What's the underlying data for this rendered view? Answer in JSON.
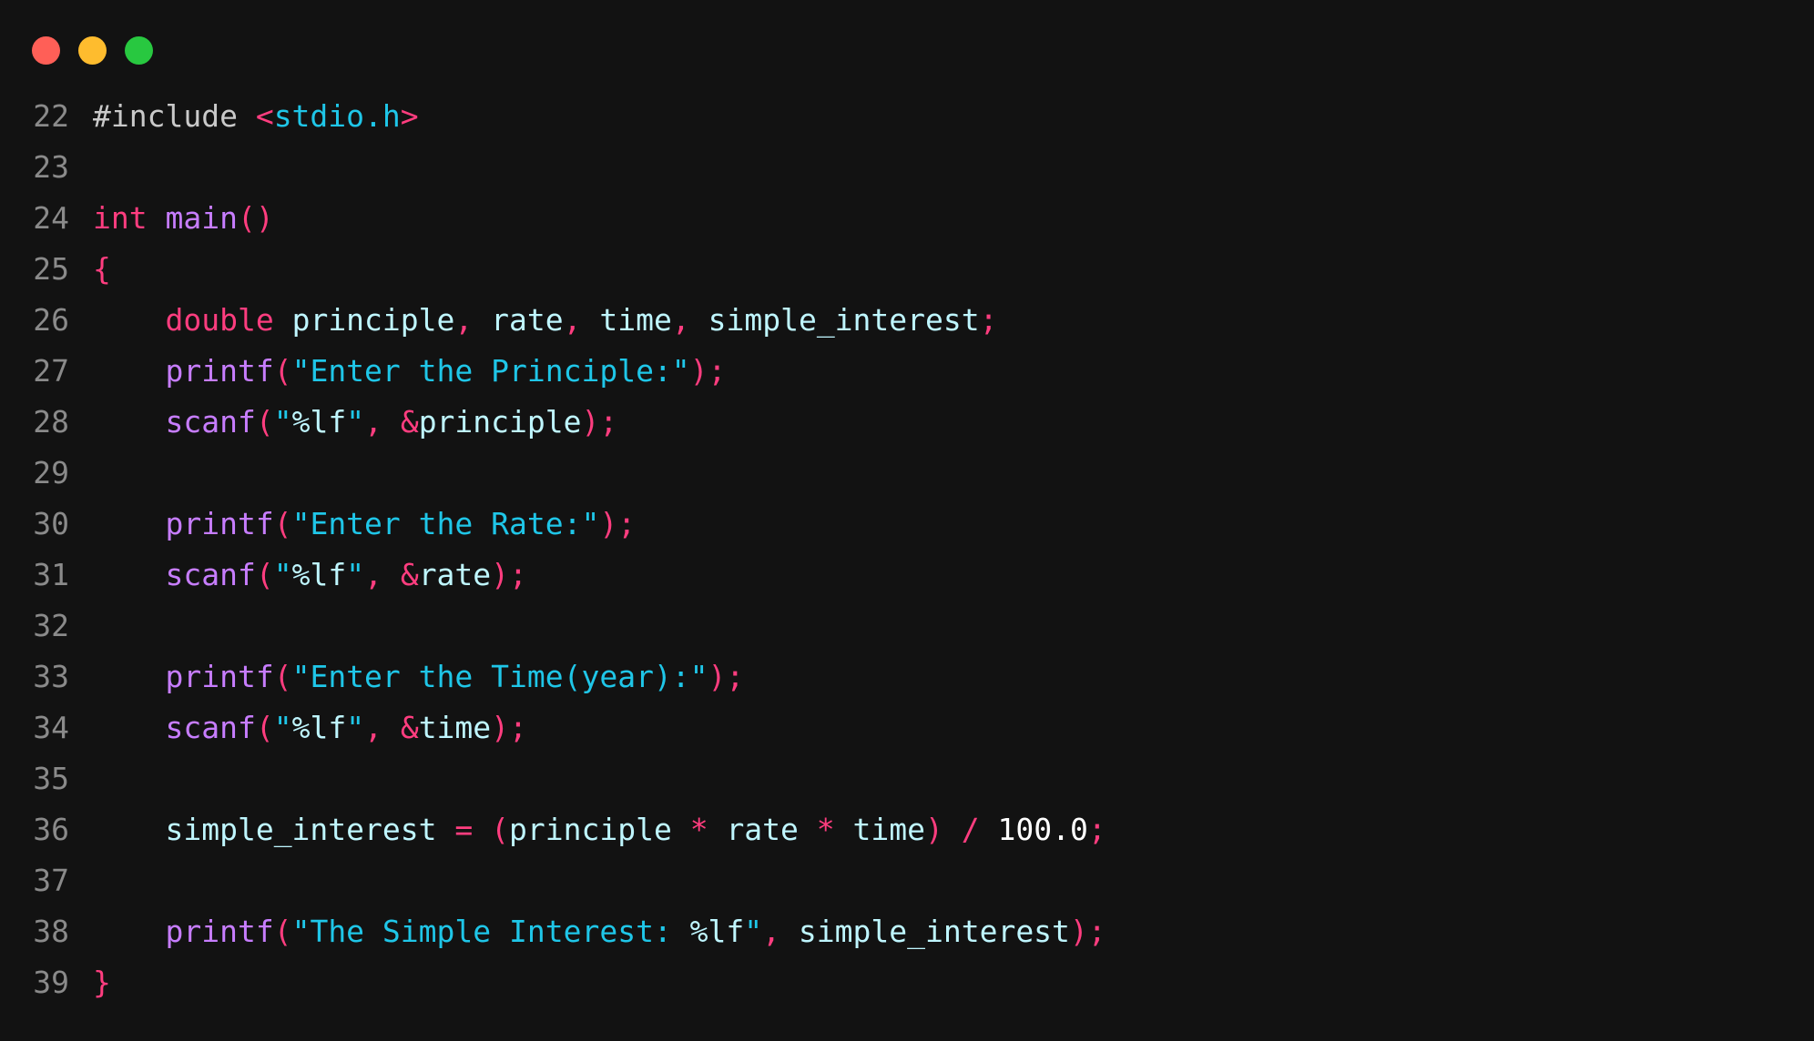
{
  "window": {
    "controls": [
      {
        "name": "close",
        "color": "#ff5f57"
      },
      {
        "name": "minimize",
        "color": "#febc2e"
      },
      {
        "name": "maximize",
        "color": "#28c840"
      }
    ]
  },
  "colors": {
    "keyword": "#ff3d7f",
    "function": "#c77dff",
    "string": "#1fc6e8",
    "identifier": "#bff6ff",
    "punct": "#ff3d7f",
    "preproc": "#c9c9c9",
    "number": "#ffffff",
    "gutter": "#8a8a8a"
  },
  "lines": [
    {
      "n": "22",
      "tokens": [
        [
          "preproc",
          "#include "
        ],
        [
          "punct",
          "<"
        ],
        [
          "string",
          "stdio.h"
        ],
        [
          "punct",
          ">"
        ]
      ]
    },
    {
      "n": "23",
      "tokens": []
    },
    {
      "n": "24",
      "tokens": [
        [
          "keyword",
          "int"
        ],
        [
          "plain",
          " "
        ],
        [
          "function",
          "main"
        ],
        [
          "punct",
          "()"
        ]
      ]
    },
    {
      "n": "25",
      "tokens": [
        [
          "punct",
          "{"
        ]
      ]
    },
    {
      "n": "26",
      "tokens": [
        [
          "plain",
          "    "
        ],
        [
          "keyword",
          "double"
        ],
        [
          "plain",
          " "
        ],
        [
          "identifier",
          "principle"
        ],
        [
          "punct",
          ","
        ],
        [
          "plain",
          " "
        ],
        [
          "identifier",
          "rate"
        ],
        [
          "punct",
          ","
        ],
        [
          "plain",
          " "
        ],
        [
          "identifier",
          "time"
        ],
        [
          "punct",
          ","
        ],
        [
          "plain",
          " "
        ],
        [
          "identifier",
          "simple_interest"
        ],
        [
          "punct",
          ";"
        ]
      ]
    },
    {
      "n": "27",
      "tokens": [
        [
          "plain",
          "    "
        ],
        [
          "function",
          "printf"
        ],
        [
          "punct",
          "("
        ],
        [
          "string",
          "\"Enter the Principle:\""
        ],
        [
          "punct",
          ");"
        ]
      ]
    },
    {
      "n": "28",
      "tokens": [
        [
          "plain",
          "    "
        ],
        [
          "function",
          "scanf"
        ],
        [
          "punct",
          "("
        ],
        [
          "string",
          "\""
        ],
        [
          "identifier",
          "%lf"
        ],
        [
          "string",
          "\""
        ],
        [
          "punct",
          ","
        ],
        [
          "plain",
          " "
        ],
        [
          "punct",
          "&"
        ],
        [
          "identifier",
          "principle"
        ],
        [
          "punct",
          ");"
        ]
      ]
    },
    {
      "n": "29",
      "tokens": []
    },
    {
      "n": "30",
      "tokens": [
        [
          "plain",
          "    "
        ],
        [
          "function",
          "printf"
        ],
        [
          "punct",
          "("
        ],
        [
          "string",
          "\"Enter the Rate:\""
        ],
        [
          "punct",
          ");"
        ]
      ]
    },
    {
      "n": "31",
      "tokens": [
        [
          "plain",
          "    "
        ],
        [
          "function",
          "scanf"
        ],
        [
          "punct",
          "("
        ],
        [
          "string",
          "\""
        ],
        [
          "identifier",
          "%lf"
        ],
        [
          "string",
          "\""
        ],
        [
          "punct",
          ","
        ],
        [
          "plain",
          " "
        ],
        [
          "punct",
          "&"
        ],
        [
          "identifier",
          "rate"
        ],
        [
          "punct",
          ");"
        ]
      ]
    },
    {
      "n": "32",
      "tokens": []
    },
    {
      "n": "33",
      "tokens": [
        [
          "plain",
          "    "
        ],
        [
          "function",
          "printf"
        ],
        [
          "punct",
          "("
        ],
        [
          "string",
          "\"Enter the Time(year):\""
        ],
        [
          "punct",
          ");"
        ]
      ]
    },
    {
      "n": "34",
      "tokens": [
        [
          "plain",
          "    "
        ],
        [
          "function",
          "scanf"
        ],
        [
          "punct",
          "("
        ],
        [
          "string",
          "\""
        ],
        [
          "identifier",
          "%lf"
        ],
        [
          "string",
          "\""
        ],
        [
          "punct",
          ","
        ],
        [
          "plain",
          " "
        ],
        [
          "punct",
          "&"
        ],
        [
          "identifier",
          "time"
        ],
        [
          "punct",
          ");"
        ]
      ]
    },
    {
      "n": "35",
      "tokens": []
    },
    {
      "n": "36",
      "tokens": [
        [
          "plain",
          "    "
        ],
        [
          "identifier",
          "simple_interest"
        ],
        [
          "plain",
          " "
        ],
        [
          "punct",
          "="
        ],
        [
          "plain",
          " "
        ],
        [
          "punct",
          "("
        ],
        [
          "identifier",
          "principle"
        ],
        [
          "plain",
          " "
        ],
        [
          "punct",
          "*"
        ],
        [
          "plain",
          " "
        ],
        [
          "identifier",
          "rate"
        ],
        [
          "plain",
          " "
        ],
        [
          "punct",
          "*"
        ],
        [
          "plain",
          " "
        ],
        [
          "identifier",
          "time"
        ],
        [
          "punct",
          ")"
        ],
        [
          "plain",
          " "
        ],
        [
          "punct",
          "/"
        ],
        [
          "plain",
          " "
        ],
        [
          "number",
          "100.0"
        ],
        [
          "punct",
          ";"
        ]
      ]
    },
    {
      "n": "37",
      "tokens": []
    },
    {
      "n": "38",
      "tokens": [
        [
          "plain",
          "    "
        ],
        [
          "function",
          "printf"
        ],
        [
          "punct",
          "("
        ],
        [
          "string",
          "\"The Simple Interest: "
        ],
        [
          "identifier",
          "%lf"
        ],
        [
          "string",
          "\""
        ],
        [
          "punct",
          ","
        ],
        [
          "plain",
          " "
        ],
        [
          "identifier",
          "simple_interest"
        ],
        [
          "punct",
          ");"
        ]
      ]
    },
    {
      "n": "39",
      "tokens": [
        [
          "punct",
          "}"
        ]
      ]
    }
  ]
}
